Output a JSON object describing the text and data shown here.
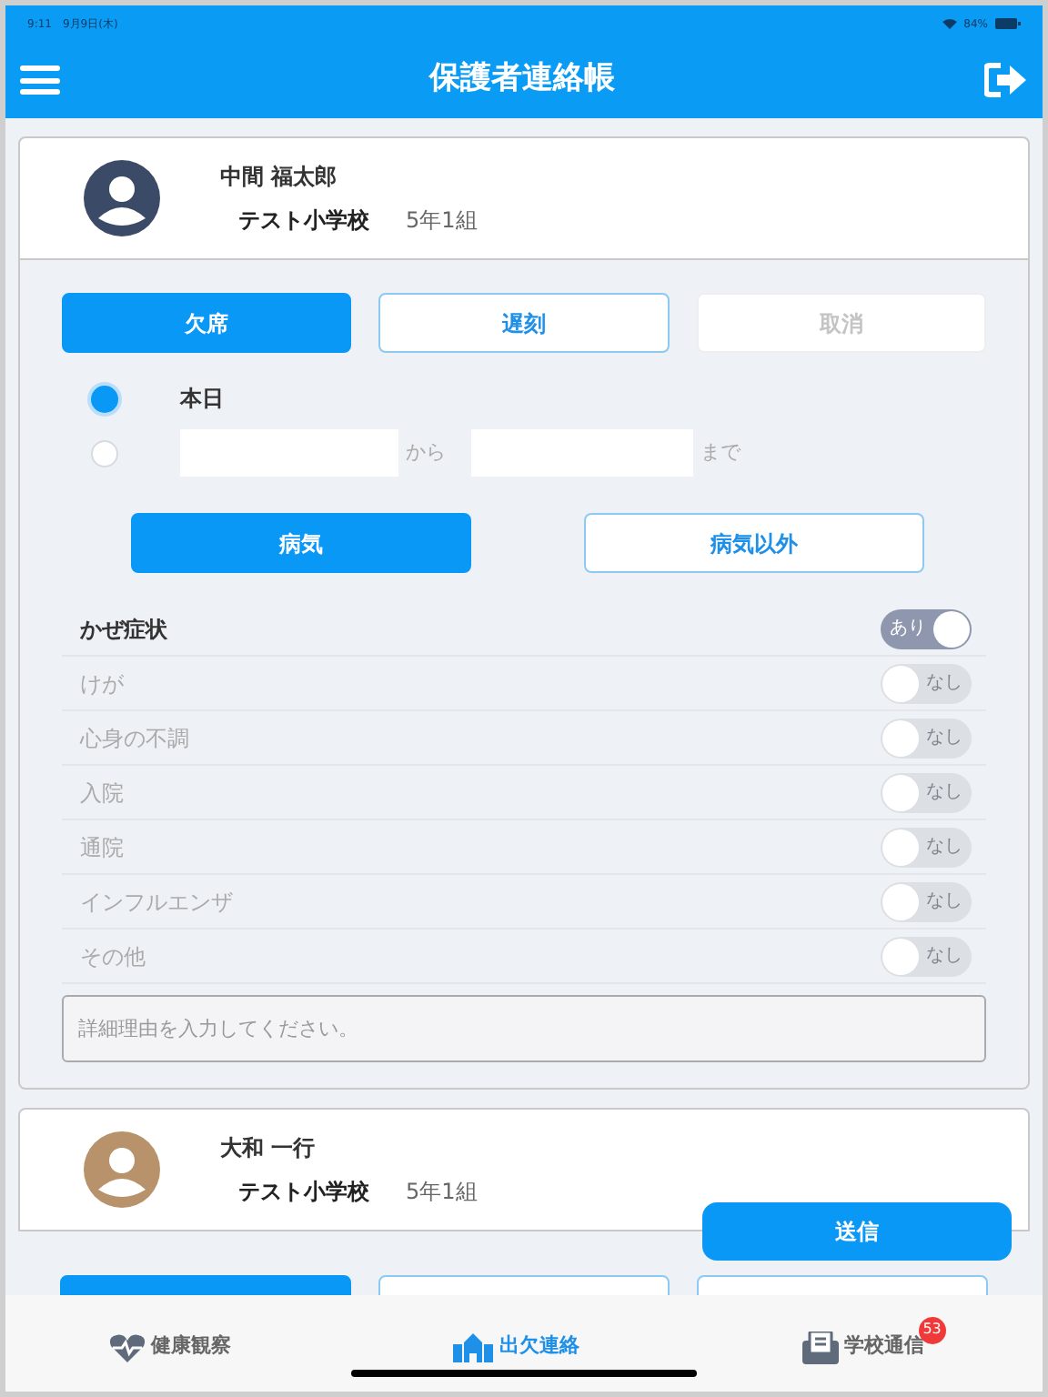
{
  "status_bar": {
    "time": "9:11",
    "date": "9月9日(木)",
    "battery": "84%"
  },
  "header": {
    "title": "保護者連絡帳"
  },
  "students": [
    {
      "name": "中間 福太郎",
      "school": "テスト小学校",
      "grade": "5年1組",
      "color": "#3b4a66",
      "expanded": true,
      "types": [
        {
          "label": "欠席",
          "selected": true,
          "disabled": false
        },
        {
          "label": "遅刻",
          "selected": false,
          "disabled": false
        },
        {
          "label": "取消",
          "selected": false,
          "disabled": true
        }
      ],
      "date_options": [
        {
          "kind": "today",
          "label": "本日",
          "selected": true
        },
        {
          "kind": "range",
          "from": "から",
          "to": "まで",
          "selected": false
        }
      ],
      "reasons": [
        {
          "label": "病気",
          "selected": true
        },
        {
          "label": "病気以外",
          "selected": false
        }
      ],
      "symptoms": [
        {
          "label": "かぜ症状",
          "on": true,
          "state_text": "あり"
        },
        {
          "label": "けが",
          "on": false,
          "state_text": "なし"
        },
        {
          "label": "心身の不調",
          "on": false,
          "state_text": "なし"
        },
        {
          "label": "入院",
          "on": false,
          "state_text": "なし"
        },
        {
          "label": "通院",
          "on": false,
          "state_text": "なし"
        },
        {
          "label": "インフルエンザ",
          "on": false,
          "state_text": "なし"
        },
        {
          "label": "その他",
          "on": false,
          "state_text": "なし"
        }
      ],
      "detail": {
        "placeholder": "詳細理由を入力してください。"
      }
    },
    {
      "name": "大和 一行",
      "school": "テスト小学校",
      "grade": "5年1組",
      "color": "#b8926a",
      "expanded": false,
      "type_buttons_selected": [
        true,
        false,
        false
      ]
    }
  ],
  "send_button": "送信",
  "tabs": [
    {
      "label": "健康観察",
      "kind": "heart",
      "selected": false
    },
    {
      "label": "出欠連絡",
      "kind": "school",
      "selected": true
    },
    {
      "label": "学校通信",
      "kind": "mail",
      "selected": false,
      "badge": "53"
    }
  ]
}
